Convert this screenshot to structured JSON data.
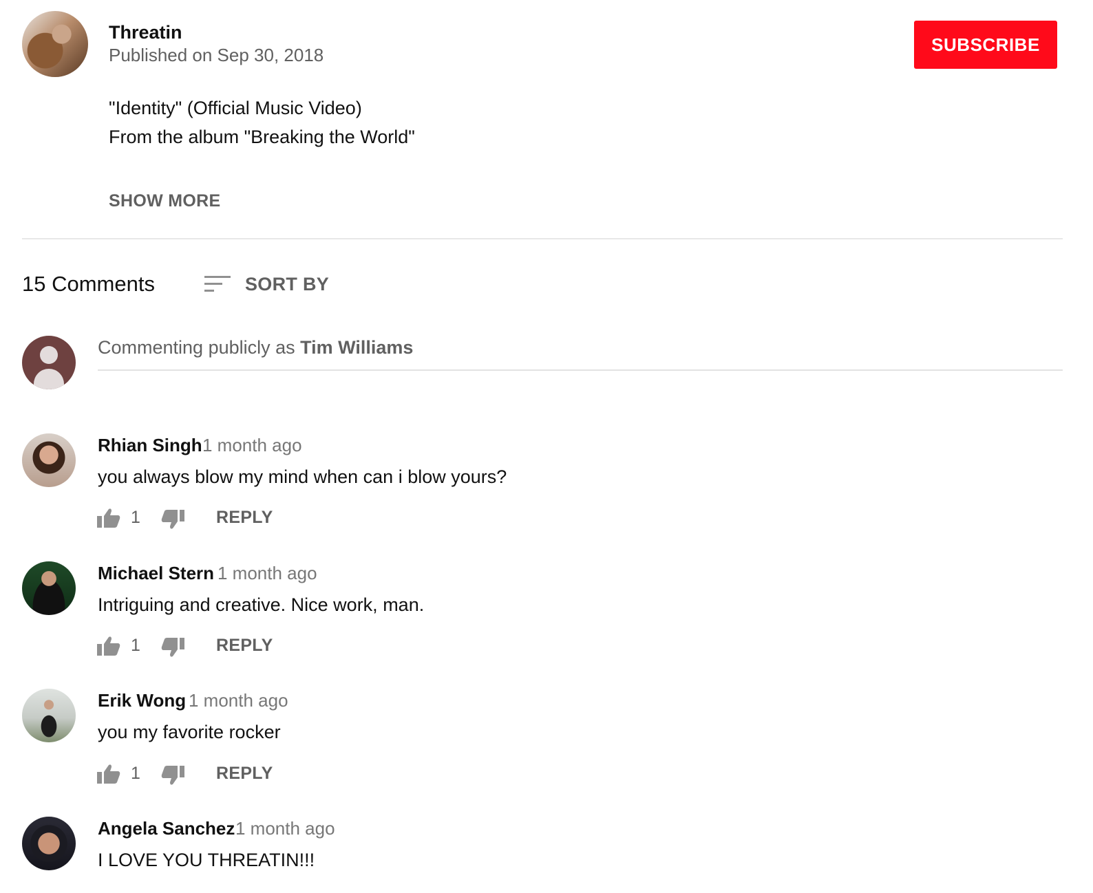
{
  "channel": {
    "name": "Threatin",
    "published": "Published on Sep 30, 2018",
    "subscribe_label": "SUBSCRIBE"
  },
  "description": {
    "lines": [
      "\"Identity\" (Official Music Video)",
      "From the album \"Breaking the World\""
    ],
    "show_more": "SHOW MORE"
  },
  "comments_header": {
    "count_label": "15 Comments",
    "sort_label": "SORT BY"
  },
  "comment_box": {
    "prefix": "Commenting publicly as",
    "user": "Tim Williams"
  },
  "comments": [
    {
      "author": "Rhian Singh",
      "time": "1 month ago",
      "text": "you always blow my mind when can i blow yours?",
      "likes": "1",
      "reply_label": "REPLY"
    },
    {
      "author": "Michael Stern",
      "time": "1 month ago",
      "text": "Intriguing and creative. Nice work, man.",
      "likes": "1",
      "reply_label": "REPLY"
    },
    {
      "author": "Erik Wong",
      "time": "1 month ago",
      "text": "you my favorite rocker",
      "likes": "1",
      "reply_label": "REPLY"
    },
    {
      "author": "Angela Sanchez",
      "time": "1 month ago",
      "text": "I LOVE YOU THREATIN!!!"
    }
  ],
  "colors": {
    "subscribe_bg": "#ff0a1a",
    "secondary_text": "#606060"
  },
  "icons": [
    "sort-icon",
    "thumbs-up-icon",
    "thumbs-down-icon",
    "default-avatar-icon"
  ]
}
